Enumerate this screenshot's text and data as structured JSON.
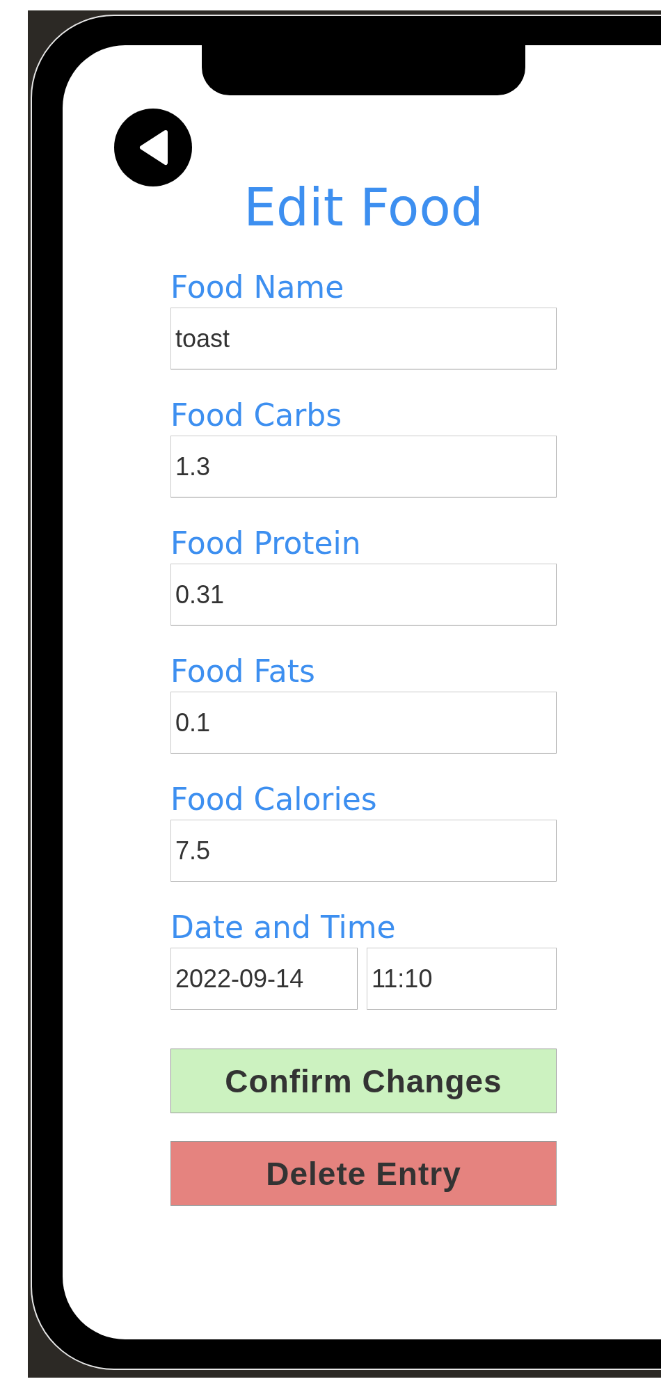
{
  "title": "Edit Food",
  "fields": [
    {
      "label": "Food Name",
      "value": "toast"
    },
    {
      "label": "Food Carbs",
      "value": "1.3"
    },
    {
      "label": "Food Protein",
      "value": "0.31"
    },
    {
      "label": "Food Fats",
      "value": "0.1"
    },
    {
      "label": "Food Calories",
      "value": "7.5"
    }
  ],
  "date_time": {
    "label": "Date and Time",
    "date": "2022-09-14",
    "time": "11:10"
  },
  "buttons": [
    {
      "label": "Confirm Changes",
      "kind": "confirm"
    },
    {
      "label": "Delete Entry",
      "kind": "delete"
    }
  ]
}
